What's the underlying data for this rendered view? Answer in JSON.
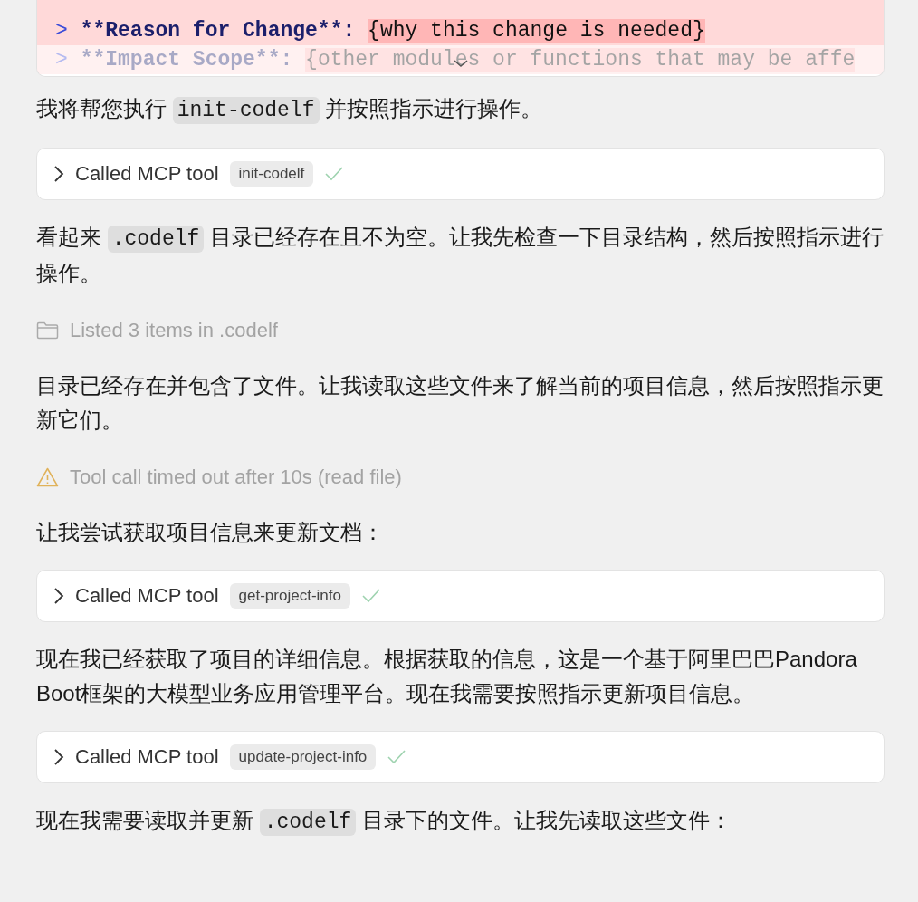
{
  "code_block": {
    "collapsed": true,
    "lines": [
      {
        "marker": ">",
        "key": "**Reason for Change**:",
        "value": "{why this change is needed}"
      },
      {
        "marker": ">",
        "key": "**Impact Scope**:",
        "value": "{other modules or functions that may be affe"
      }
    ]
  },
  "messages": [
    {
      "kind": "paragraph",
      "segments": [
        {
          "kind": "text",
          "text": "我将帮您执行 "
        },
        {
          "kind": "code",
          "text": "init-codelf"
        },
        {
          "kind": "text",
          "text": " 并按照指示进行操作。"
        }
      ]
    },
    {
      "kind": "tool_call",
      "label": "Called MCP tool",
      "tool": "init-codelf",
      "done": true
    },
    {
      "kind": "paragraph",
      "segments": [
        {
          "kind": "text",
          "text": "看起来 "
        },
        {
          "kind": "code",
          "text": ".codelf"
        },
        {
          "kind": "text",
          "text": " 目录已经存在且不为空。让我先检查一下目录结构，然后按照指示进行操作。"
        }
      ]
    },
    {
      "kind": "listing",
      "text": "Listed 3 items in .codelf"
    },
    {
      "kind": "paragraph",
      "segments": [
        {
          "kind": "text",
          "text": "目录已经存在并包含了文件。让我读取这些文件来了解当前的项目信息，然后按照指示更新它们。"
        }
      ]
    },
    {
      "kind": "timeout",
      "text": "Tool call timed out after 10s (read file)"
    },
    {
      "kind": "paragraph",
      "segments": [
        {
          "kind": "text",
          "text": "让我尝试获取项目信息来更新文档："
        }
      ]
    },
    {
      "kind": "tool_call",
      "label": "Called MCP tool",
      "tool": "get-project-info",
      "done": true
    },
    {
      "kind": "paragraph",
      "segments": [
        {
          "kind": "text",
          "text": "现在我已经获取了项目的详细信息。根据获取的信息，这是一个基于阿里巴巴Pandora Boot框架的大模型业务应用管理平台。现在我需要按照指示更新项目信息。"
        }
      ]
    },
    {
      "kind": "tool_call",
      "label": "Called MCP tool",
      "tool": "update-project-info",
      "done": true
    },
    {
      "kind": "paragraph",
      "segments": [
        {
          "kind": "text",
          "text": "现在我需要读取并更新 "
        },
        {
          "kind": "code",
          "text": ".codelf"
        },
        {
          "kind": "text",
          "text": " 目录下的文件。让我先读取这些文件："
        }
      ]
    }
  ]
}
